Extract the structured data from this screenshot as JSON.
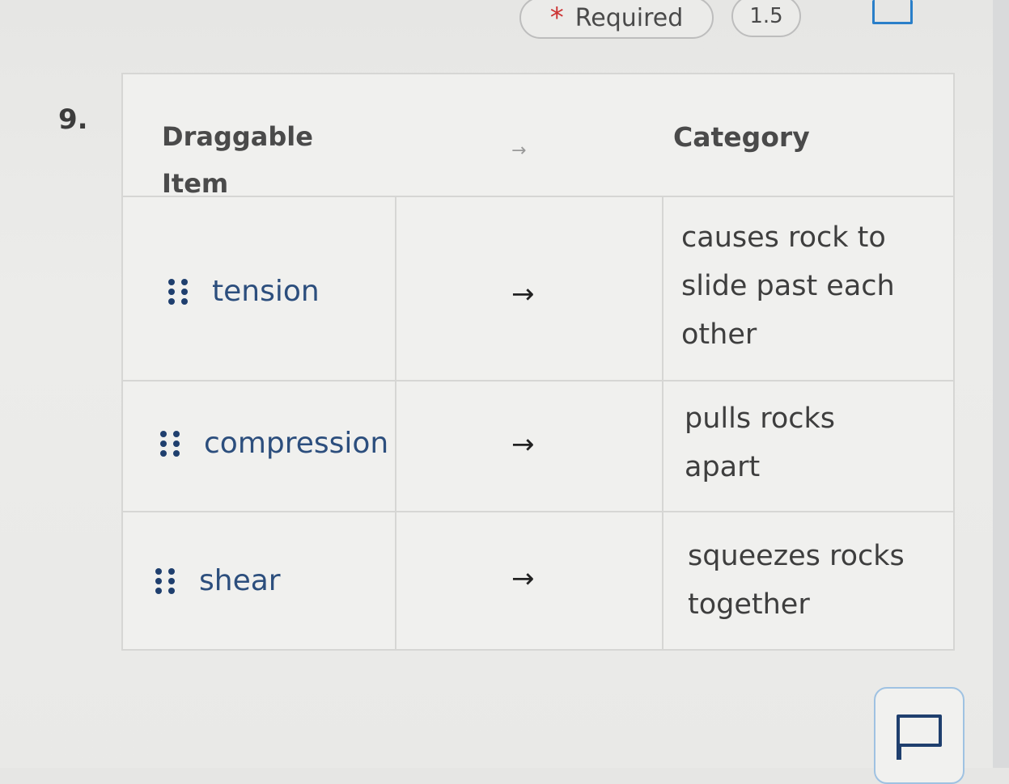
{
  "header": {
    "required_star": "*",
    "required_label": "Required",
    "points": "1.5"
  },
  "question": {
    "number": "9.",
    "column_item_header": "Draggable Item",
    "column_category_header": "Category",
    "arrow": "→",
    "rows": [
      {
        "item": "tension",
        "category": "causes rock to slide past each other"
      },
      {
        "item": "compression",
        "category": "pulls rocks apart"
      },
      {
        "item": "shear",
        "category": "squeezes rocks together"
      }
    ]
  },
  "icons": {
    "flag": "flag-icon",
    "grip": "drag-handle-icon",
    "comment": "comment-icon"
  },
  "colors": {
    "accent": "#2a7fc9",
    "item_text": "#2c4e7d",
    "required_star": "#cc3333"
  }
}
